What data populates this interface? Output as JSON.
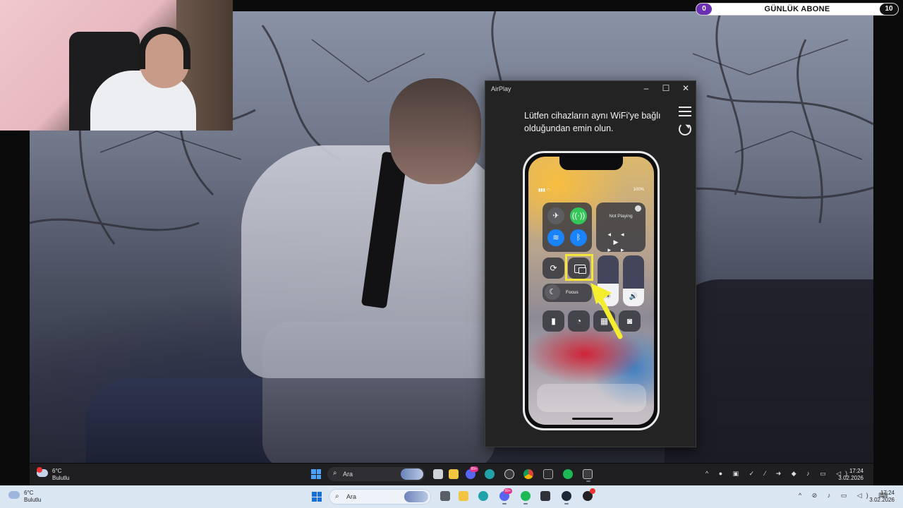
{
  "subscriber_goal": {
    "label": "GÜNLÜK ABONE",
    "current": "0",
    "target": "10",
    "progress_fraction": 0
  },
  "airplay": {
    "title": "AirPlay",
    "message": "Lütfen cihazların aynı WiFi'ye bağlı olduğundan emin olun.",
    "controls": {
      "minimize": "–",
      "maximize": "☐",
      "close": "✕"
    },
    "phone": {
      "battery": "100%",
      "now_playing": "Not Playing",
      "focus_label": "Focus",
      "highlight_color": "#f5e43a",
      "brightness_level": 0.45,
      "volume_level": 0.35
    }
  },
  "inner_taskbar": {
    "weather_temp": "6°C",
    "weather_desc": "Bulutlu",
    "search_placeholder": "Ara",
    "time": "17:24",
    "date": "3.02.2026",
    "discord_badge": "99+"
  },
  "outer_taskbar": {
    "weather_temp": "6°C",
    "weather_desc": "Bulutlu",
    "search_placeholder": "Ara",
    "time": "17:24",
    "date": "3.02.2026",
    "discord_badge": "99+"
  },
  "icons": {
    "start": "windows-start-icon",
    "search": "search-icon",
    "airplane": "airplane-icon",
    "wifi": "wifi-icon",
    "bluetooth": "bluetooth-icon",
    "cellular": "cellular-icon",
    "screen_mirroring": "screen-mirroring-icon",
    "flashlight": "flashlight-icon",
    "timer": "timer-icon",
    "camera": "camera-icon"
  }
}
